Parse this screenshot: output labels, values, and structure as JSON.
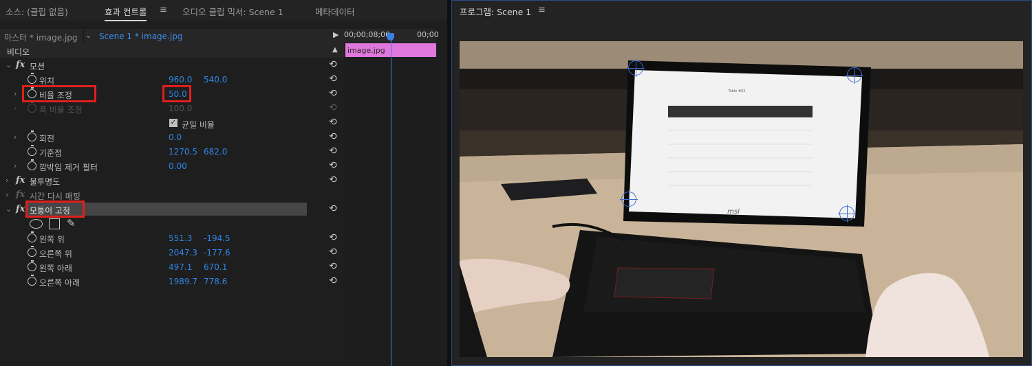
{
  "tabs": {
    "source": "소스: (클립 없음)",
    "effect_controls": "효과 컨트롤",
    "audio_mixer": "오디오 클립 믹서: Scene 1",
    "metadata": "메타데이터",
    "menu_glyph": "≡"
  },
  "source_bar": {
    "master": "마스터 * image.jpg",
    "clip": "Scene 1 * image.jpg"
  },
  "timeline": {
    "time_start": "00;00;08;00",
    "time_end": "00;00",
    "clip_label": "image.jpg"
  },
  "sections": {
    "video": "비디오",
    "motion": "모션",
    "opacity": "불투명도",
    "time_remap": "시간 다시 매핑",
    "corner_pin": "모퉁이 고정"
  },
  "properties": {
    "position": {
      "label": "위치",
      "v1": "960.0",
      "v2": "540.0"
    },
    "scale": {
      "label": "비율 조정",
      "v1": "50.0"
    },
    "scale_width": {
      "label": "폭 비율 조정",
      "v1": "100.0"
    },
    "uniform_scale": {
      "label": "균일 비율"
    },
    "rotation": {
      "label": "회전",
      "v1": "0.0"
    },
    "anchor": {
      "label": "기준점",
      "v1": "1270.5",
      "v2": "682.0"
    },
    "flicker": {
      "label": "깜박임 제거 필터",
      "v1": "0.00"
    },
    "upper_left": {
      "label": "왼쪽 위",
      "v1": "551.3",
      "v2": "-194.5"
    },
    "upper_right": {
      "label": "오른쪽 위",
      "v1": "2047.3",
      "v2": "-177.6"
    },
    "lower_left": {
      "label": "왼쪽 아래",
      "v1": "497.1",
      "v2": "670.1"
    },
    "lower_right": {
      "label": "오른쪽 아래",
      "v1": "1989.7",
      "v2": "778.6"
    }
  },
  "program": {
    "title": "프로그램: Scene 1",
    "screen_title": "Table #02",
    "laptop_brand": "msi"
  },
  "colors": {
    "accent_blue": "#2f86e6",
    "highlight_red": "#e0201e",
    "clip_pink": "#e077dd"
  }
}
